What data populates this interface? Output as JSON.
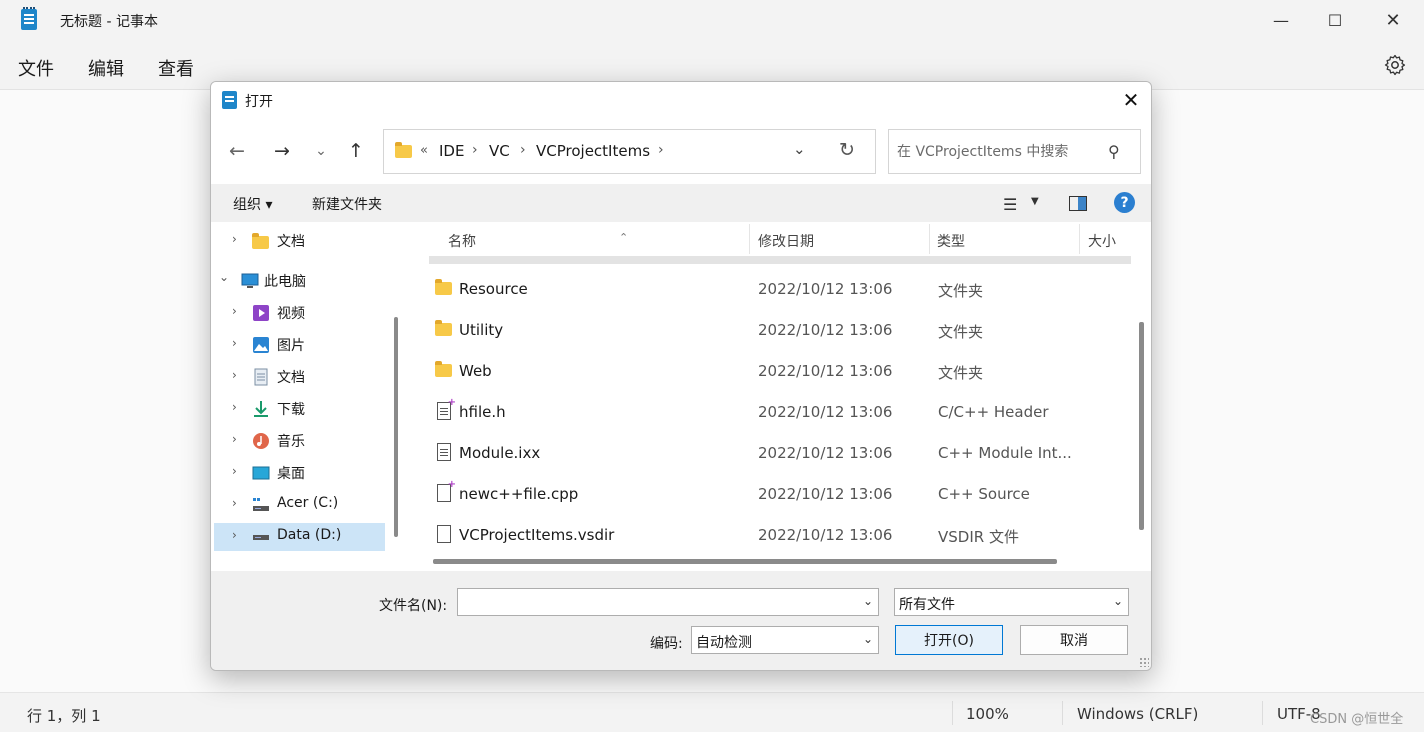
{
  "notepad": {
    "title": "无标题 - 记事本",
    "menus": [
      "文件",
      "编辑",
      "查看"
    ],
    "status": {
      "position": "行 1，列 1",
      "zoom": "100%",
      "line_ending": "Windows (CRLF)",
      "encoding": "UTF-8"
    },
    "watermark": "CSDN @恒世全"
  },
  "dialog": {
    "title": "打开",
    "nav": {
      "back": "←",
      "forward": "→",
      "recent": "⌄",
      "up": "↑"
    },
    "address": {
      "overflow": "«",
      "crumbs": [
        "IDE",
        "VC",
        "VCProjectItems"
      ]
    },
    "search": {
      "placeholder": "在 VCProjectItems 中搜索"
    },
    "toolbar": {
      "organize": "组织 ▾",
      "new_folder": "新建文件夹",
      "help": "?"
    },
    "sidebar": [
      {
        "label": "文档",
        "icon": "folder-icon",
        "expand": "›"
      },
      {
        "label": "此电脑",
        "icon": "computer-icon",
        "expand": "⌄"
      },
      {
        "label": "视频",
        "icon": "video-icon",
        "expand": "›"
      },
      {
        "label": "图片",
        "icon": "picture-icon",
        "expand": "›"
      },
      {
        "label": "文档",
        "icon": "document-icon",
        "expand": "›"
      },
      {
        "label": "下载",
        "icon": "download-icon",
        "expand": "›"
      },
      {
        "label": "音乐",
        "icon": "music-icon",
        "expand": "›"
      },
      {
        "label": "桌面",
        "icon": "desktop-icon",
        "expand": "›"
      },
      {
        "label": "Acer (C:)",
        "icon": "drive-icon",
        "expand": "›"
      },
      {
        "label": "Data (D:)",
        "icon": "drive-icon",
        "expand": "›"
      }
    ],
    "columns": [
      "名称",
      "修改日期",
      "类型",
      "大小"
    ],
    "files": [
      {
        "name": "Resource",
        "date": "2022/10/12 13:06",
        "type": "文件夹",
        "icon": "folder-icon"
      },
      {
        "name": "Utility",
        "date": "2022/10/12 13:06",
        "type": "文件夹",
        "icon": "folder-icon"
      },
      {
        "name": "Web",
        "date": "2022/10/12 13:06",
        "type": "文件夹",
        "icon": "folder-icon"
      },
      {
        "name": "hfile.h",
        "date": "2022/10/12 13:06",
        "type": "C/C++ Header",
        "icon": "header-file-icon"
      },
      {
        "name": "Module.ixx",
        "date": "2022/10/12 13:06",
        "type": "C++ Module Int...",
        "icon": "module-file-icon"
      },
      {
        "name": "newc++file.cpp",
        "date": "2022/10/12 13:06",
        "type": "C++ Source",
        "icon": "cpp-file-icon"
      },
      {
        "name": "VCProjectItems.vsdir",
        "date": "2022/10/12 13:06",
        "type": "VSDIR 文件",
        "icon": "blank-file-icon"
      }
    ],
    "footer": {
      "filename_label": "文件名(N):",
      "filename_value": "",
      "filter_value": "所有文件",
      "encoding_label": "编码:",
      "encoding_value": "自动检测",
      "open_label": "打开(O)",
      "cancel_label": "取消"
    }
  }
}
